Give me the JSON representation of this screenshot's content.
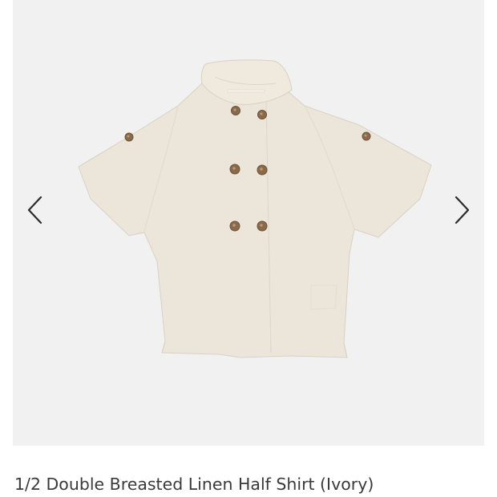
{
  "product": {
    "title": "1/2 Double Breasted Linen Half Shirt (Ivory)",
    "image_subject": "ivory double breasted linen half shirt",
    "colors": {
      "gallery_background": "#f1f1f2",
      "garment": "#ebe5d9",
      "button": "#8a6a4a",
      "arrow": "#2b2b2b",
      "title_text": "#3a3a3a"
    }
  },
  "gallery": {
    "prev_icon": "chevron-left-icon",
    "next_icon": "chevron-right-icon"
  }
}
